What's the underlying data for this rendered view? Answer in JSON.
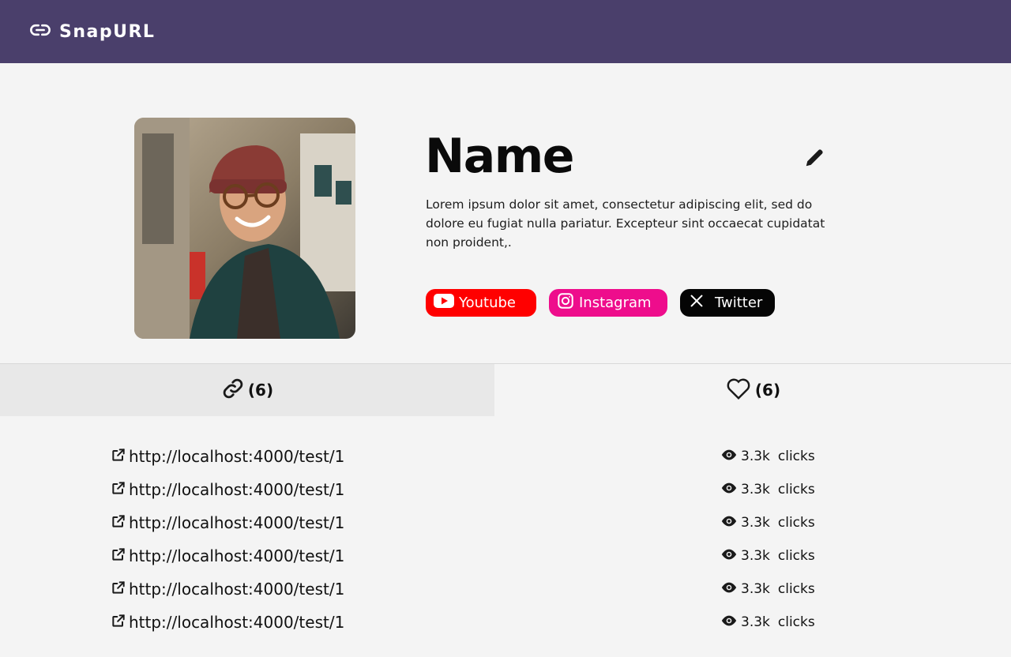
{
  "app": {
    "brand": "SnapURL"
  },
  "profile": {
    "name": "Name",
    "bio": "Lorem ipsum dolor sit amet, consectetur adipiscing elit, sed do dolore eu fugiat nulla pariatur. Excepteur sint occaecat cupidatat non proident,.",
    "avatar_icon": "profile-photo"
  },
  "socials": [
    {
      "label": "Youtube",
      "icon": "youtube-icon",
      "color": "#ff0000"
    },
    {
      "label": "Instagram",
      "icon": "instagram-icon",
      "color": "#ee0d8c"
    },
    {
      "label": "Twitter",
      "icon": "x-twitter-icon",
      "color": "#050505"
    }
  ],
  "tabs": {
    "links": {
      "icon": "link-icon",
      "count": "(6)"
    },
    "likes": {
      "icon": "heart-icon",
      "count": "(6)"
    }
  },
  "links": [
    {
      "url": "http://localhost:4000/test/1",
      "views": "3.3k",
      "clicks_label": "clicks"
    },
    {
      "url": "http://localhost:4000/test/1",
      "views": "3.3k",
      "clicks_label": "clicks"
    },
    {
      "url": "http://localhost:4000/test/1",
      "views": "3.3k",
      "clicks_label": "clicks"
    },
    {
      "url": "http://localhost:4000/test/1",
      "views": "3.3k",
      "clicks_label": "clicks"
    },
    {
      "url": "http://localhost:4000/test/1",
      "views": "3.3k",
      "clicks_label": "clicks"
    },
    {
      "url": "http://localhost:4000/test/1",
      "views": "3.3k",
      "clicks_label": "clicks"
    }
  ],
  "colors": {
    "header_bg": "#4a3f6b",
    "page_bg": "#f4f4f4",
    "active_tab_bg": "#e8e8e8"
  }
}
